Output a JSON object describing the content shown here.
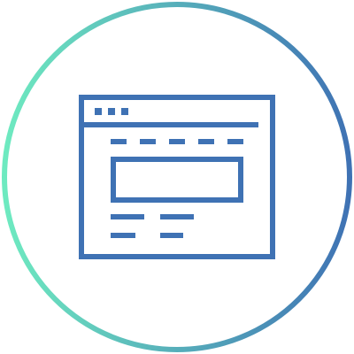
{
  "icon": {
    "name": "browser-window-icon",
    "ring_gradient": [
      "#6EEAC0",
      "#3F72B4"
    ],
    "stroke_color": "#3F72B4",
    "background": "#FFFFFF"
  }
}
